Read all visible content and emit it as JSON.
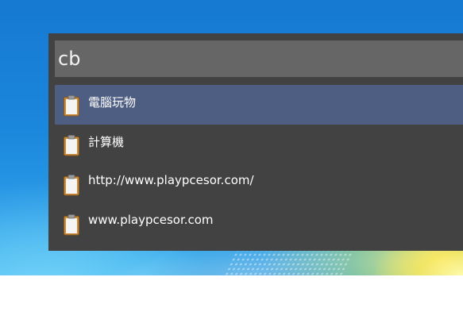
{
  "search": {
    "query": "cb"
  },
  "results": [
    {
      "label": "電腦玩物",
      "icon": "clipboard-icon",
      "selected": true
    },
    {
      "label": "計算機",
      "icon": "clipboard-icon",
      "selected": false
    },
    {
      "label": "http://www.playpcesor.com/",
      "icon": "clipboard-icon",
      "selected": false
    },
    {
      "label": "www.playpcesor.com",
      "icon": "clipboard-icon",
      "selected": false
    }
  ],
  "colors": {
    "panel": "#424242",
    "search_bar": "#666666",
    "selected_row": "#4d5e82",
    "text": "#ffffff"
  }
}
